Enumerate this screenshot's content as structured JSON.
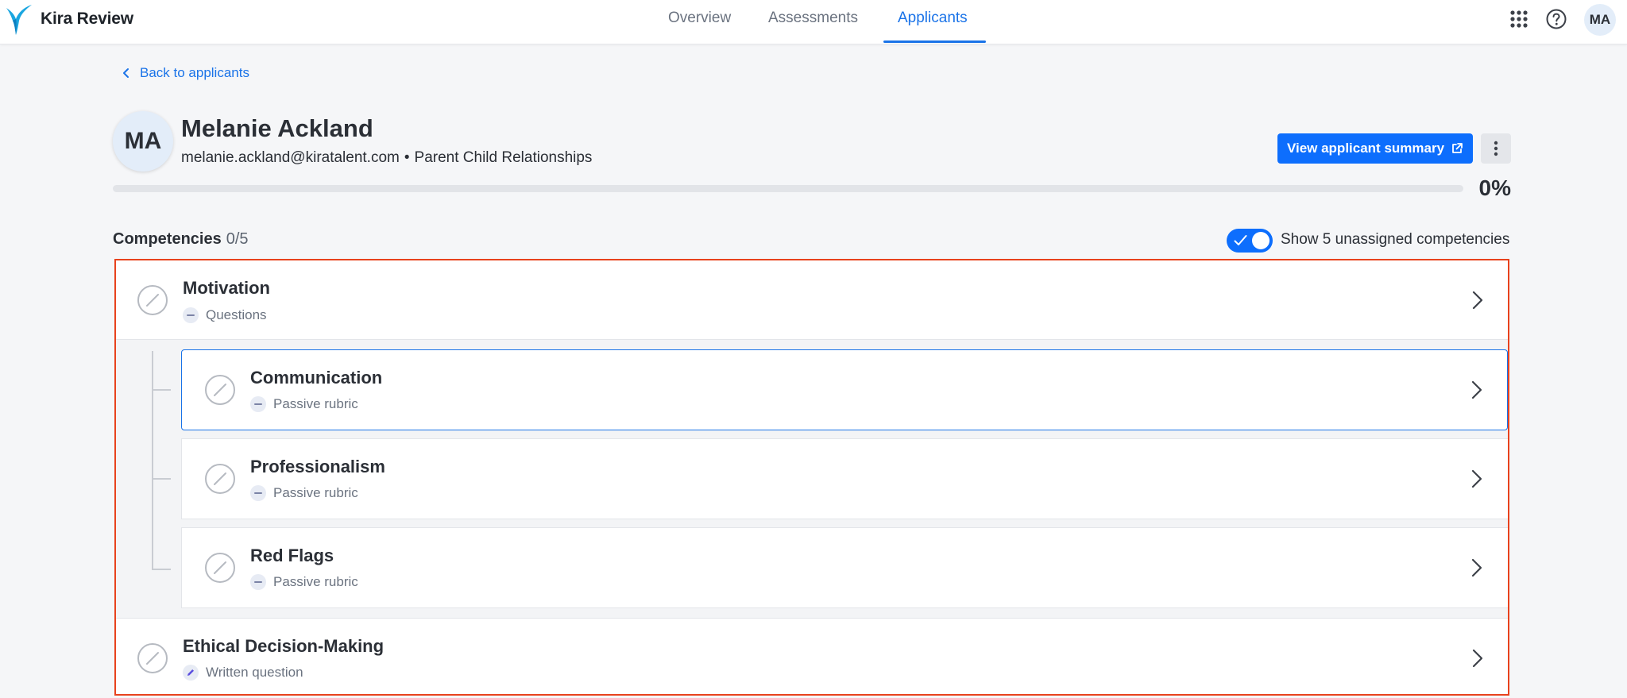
{
  "app": {
    "name": "Kira Review"
  },
  "nav": {
    "tabs": [
      {
        "label": "Overview",
        "active": false
      },
      {
        "label": "Assessments",
        "active": false
      },
      {
        "label": "Applicants",
        "active": true
      }
    ]
  },
  "header_icons": [
    "apps-grid-icon",
    "help-icon"
  ],
  "user": {
    "initials": "MA"
  },
  "back_link": {
    "label": "Back to applicants"
  },
  "applicant": {
    "initials": "MA",
    "name": "Melanie Ackland",
    "email": "melanie.ackland@kiratalent.com",
    "separator": "•",
    "program": "Parent Child Relationships",
    "progress_percent": 0,
    "progress_label": "0%"
  },
  "actions": {
    "view_summary_label": "View applicant summary"
  },
  "competencies": {
    "label": "Competencies",
    "count": "0/5",
    "toggle_on": true,
    "toggle_label": "Show 5 unassigned competencies",
    "items": [
      {
        "title": "Motivation",
        "type": "Questions",
        "badge_icon": "dash-icon",
        "status_icon": "not-started-icon"
      },
      {
        "title": "Communication",
        "type": "Passive rubric",
        "badge_icon": "dash-icon",
        "status_icon": "not-started-icon",
        "selected": true
      },
      {
        "title": "Professionalism",
        "type": "Passive rubric",
        "badge_icon": "dash-icon",
        "status_icon": "not-started-icon"
      },
      {
        "title": "Red Flags",
        "type": "Passive rubric",
        "badge_icon": "dash-icon",
        "status_icon": "not-started-icon"
      },
      {
        "title": "Ethical Decision-Making",
        "type": "Written question",
        "badge_icon": "pencil-icon",
        "status_icon": "not-started-icon"
      }
    ]
  },
  "colors": {
    "accent": "#1a73e8",
    "primary_button": "#0d6efd",
    "highlight_border": "#e8421d",
    "background": "#f5f6f8"
  }
}
